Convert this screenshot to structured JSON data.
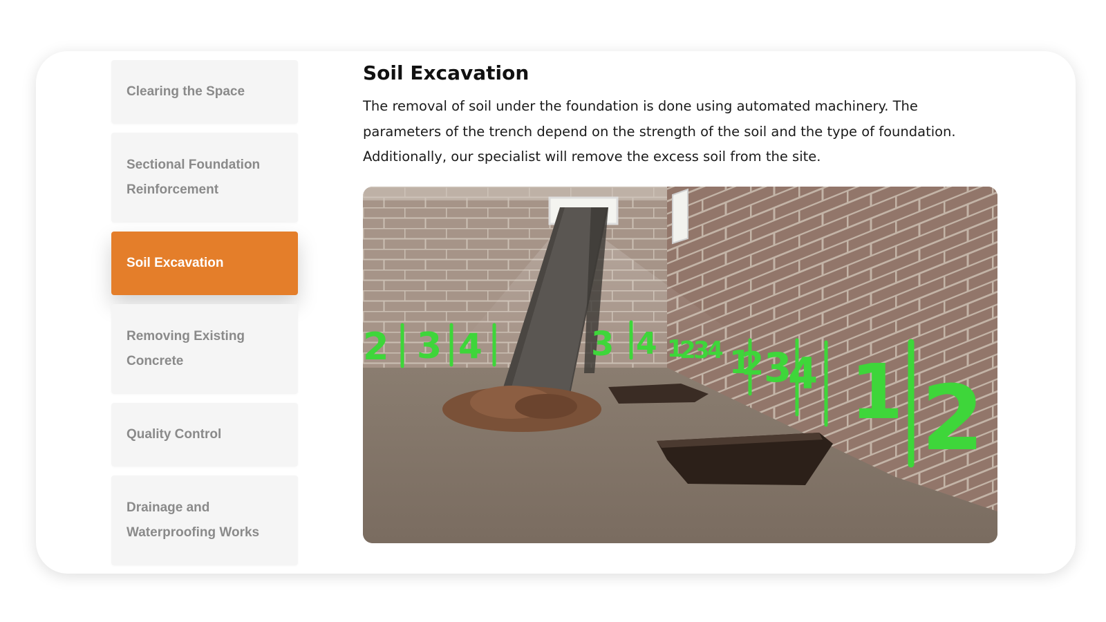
{
  "sidebar": {
    "items": [
      {
        "label_line1": "Clearing the Space",
        "label_line2": ""
      },
      {
        "label_line1": "Sectional Foundation",
        "label_line2": "Reinforcement"
      },
      {
        "label_line1": "Soil Excavation",
        "label_line2": ""
      },
      {
        "label_line1": "Removing Existing",
        "label_line2": "Concrete"
      },
      {
        "label_line1": "Quality Control",
        "label_line2": ""
      },
      {
        "label_line1": "Drainage and",
        "label_line2": "Waterproofing Works"
      }
    ],
    "active_index": 2
  },
  "main": {
    "title": "Soil Excavation",
    "description": "The removal of soil under the foundation is done using automated machinery. The parameters of the trench depend on the strength of the soil and the type of foundation. Additionally, our specialist will remove the excess soil from the site."
  },
  "image": {
    "subject": "basement-excavation-photo",
    "wall_marks": [
      "2",
      "3",
      "4",
      "3",
      "4",
      "1",
      "2",
      "3",
      "4",
      "1",
      "2",
      "3",
      "4",
      "1",
      "2"
    ]
  },
  "colors": {
    "accent": "#e47e2a",
    "tab_bg": "#f5f5f5",
    "tab_text": "#8a8a8a",
    "marker_green": "#3ed63a"
  }
}
